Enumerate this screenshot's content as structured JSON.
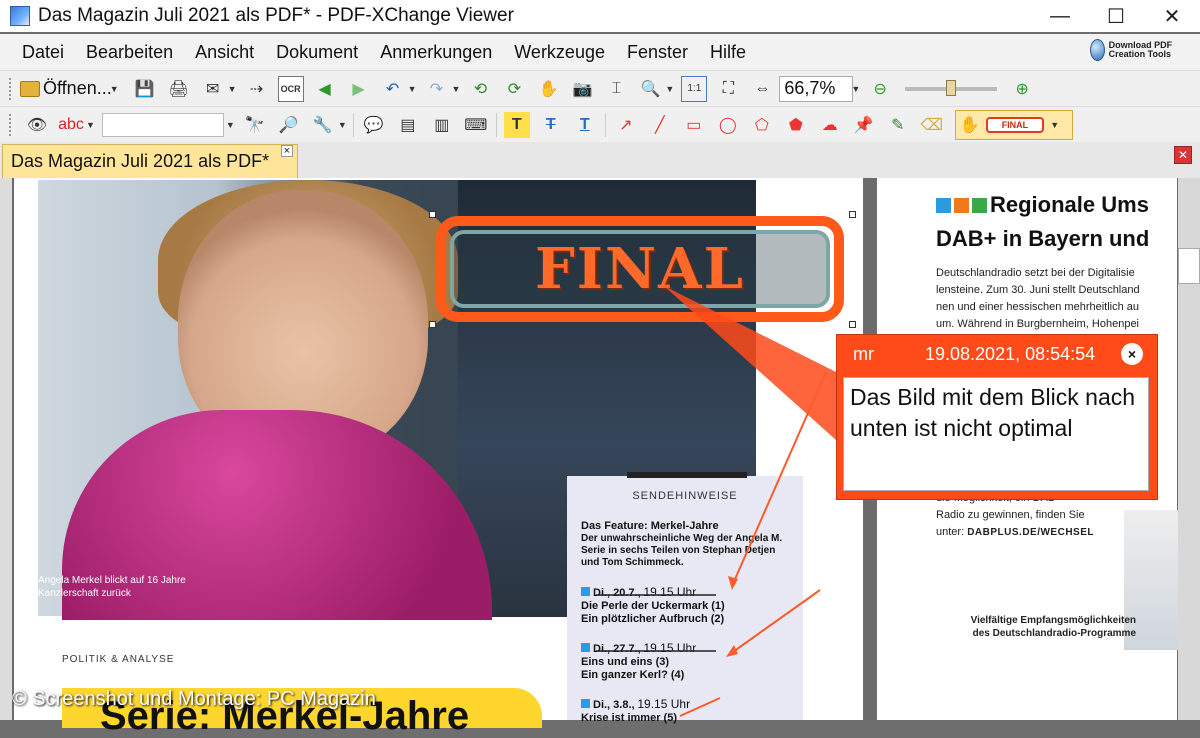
{
  "window": {
    "title": "Das Magazin Juli 2021 als PDF* - PDF-XChange Viewer",
    "minimize": "—",
    "maximize": "☐",
    "close": "✕"
  },
  "menu": [
    "Datei",
    "Bearbeiten",
    "Ansicht",
    "Dokument",
    "Anmerkungen",
    "Werkzeuge",
    "Fenster",
    "Hilfe"
  ],
  "pdfx_badge": "Download PDF Creation Tools",
  "toolbar": {
    "open_label": "Öffnen...",
    "zoom": "66,7%"
  },
  "stamp_mini": "FINAL",
  "tab": {
    "label": "Das Magazin Juli 2021 als PDF*",
    "close": "×"
  },
  "left_page": {
    "photo_caption": "Angela Merkel blickt auf 16 Jahre Kanzlerschaft zurück",
    "stamp": "FINAL",
    "sende_head": "SENDEHINWEISE",
    "feature_title": "Das Feature: Merkel-Jahre",
    "feature_text": "Der unwahrscheinliche Weg der Angela M. Serie in sechs Teilen von Stephan Detjen und Tom Schimmeck.",
    "dates": [
      {
        "day": "Di., 20.7.,",
        "time": "19.15 Uhr",
        "line1": "Die Perle der Uckermark (1)",
        "line2": "Ein plötzlicher Aufbruch (2)"
      },
      {
        "day": "Di., 27.7.,",
        "time": "19.15 Uhr",
        "line1": "Eins und eins (3)",
        "line2": "Ein ganzer Kerl? (4)"
      },
      {
        "day": "Di., 3.8.,",
        "time": "19.15 Uhr",
        "line1": "Krise ist immer (5)",
        "line2": ""
      }
    ],
    "section": "POLITIK & ANALYSE",
    "headline": "Serie: Merkel-Jahre"
  },
  "right_page": {
    "title1": "Regionale Ums",
    "title2": "DAB+ in Bayern und",
    "body": [
      "Deutschlandradio setzt bei der Digitalisie",
      "lensteine. Zum 30. Juni stellt Deutschland",
      "nen und einer hessischen mehrheitlich au",
      "um. Während in Burgbernheim, Hohenpei"
    ],
    "body2_a": "die Möglichkeit, ein DAB+",
    "body2_b": "Radio zu gewinnen, finden Sie",
    "body2_c": "unter:",
    "body2_link": "DABPLUS.DE/WECHSEL",
    "caption": "Vielfältige Empfangsmöglichkeiten des Deutschlandradio-Programme"
  },
  "comment": {
    "author": "mr",
    "date": "19.08.2021, 08:54:54",
    "close": "×",
    "text": "Das Bild mit dem Blick nach unten ist nicht optimal"
  },
  "credit": "© Screenshot und Montage: PC Magazin",
  "colors": {
    "annotation": "#ff4a1a",
    "tab": "#ffe59a",
    "jacket": "#c22a84",
    "sende_bg": "#e8e8f4"
  }
}
